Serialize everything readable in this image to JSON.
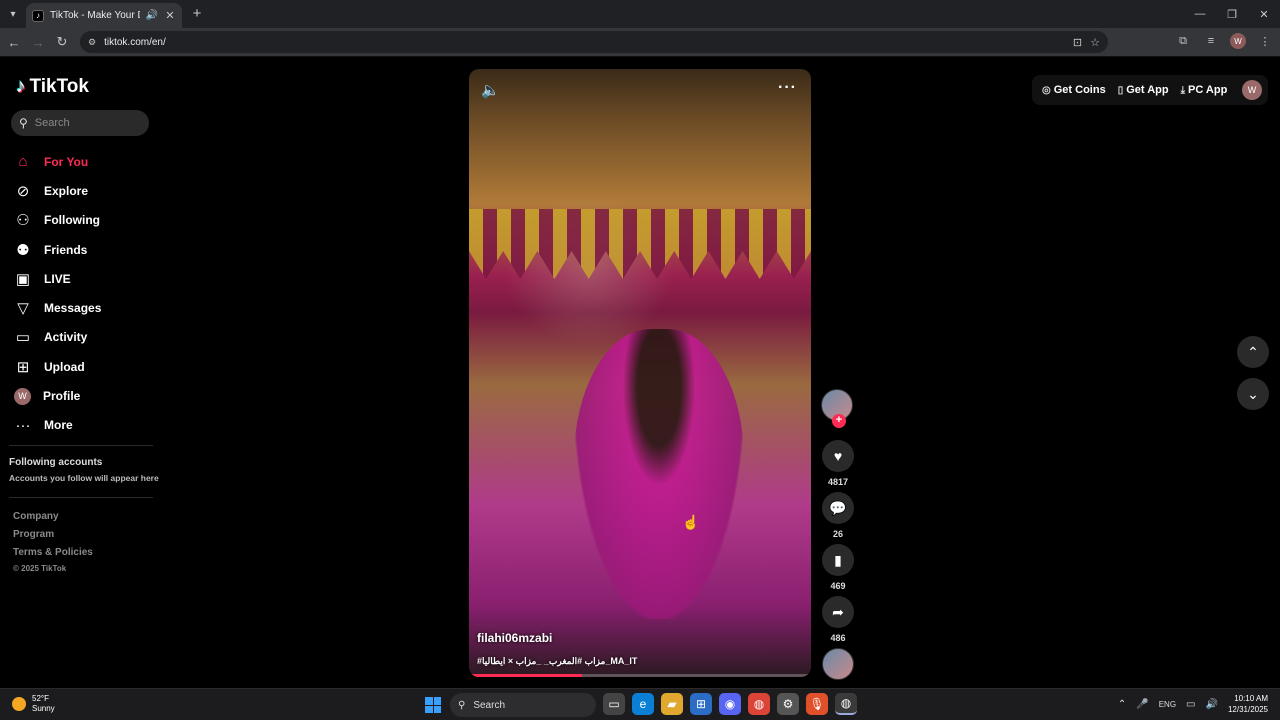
{
  "browser": {
    "tab_title": "TikTok - Make Your Day",
    "url": "tiktok.com/en/",
    "profile_initial": "W"
  },
  "sidebar": {
    "logo": "TikTok",
    "search_placeholder": "Search",
    "nav": [
      {
        "label": "For You",
        "icon": "home-icon",
        "active": true
      },
      {
        "label": "Explore",
        "icon": "compass-icon"
      },
      {
        "label": "Following",
        "icon": "user-follow-icon"
      },
      {
        "label": "Friends",
        "icon": "friends-icon"
      },
      {
        "label": "LIVE",
        "icon": "live-icon"
      },
      {
        "label": "Messages",
        "icon": "send-icon"
      },
      {
        "label": "Activity",
        "icon": "activity-icon"
      },
      {
        "label": "Upload",
        "icon": "upload-icon"
      },
      {
        "label": "Profile",
        "icon": "profile-avatar"
      },
      {
        "label": "More",
        "icon": "more-icon"
      }
    ],
    "profile_initial": "W",
    "following_title": "Following accounts",
    "following_sub": "Accounts you follow will appear here",
    "footer": [
      "Company",
      "Program",
      "Terms & Policies"
    ],
    "copyright": "© 2025 TikTok"
  },
  "video": {
    "author": "filahi06mzabi",
    "tags": "#مزاب #المغرب_ _مزاب × ايطاليا_MA_IT",
    "progress": 0.33
  },
  "actions": {
    "likes": "4817",
    "comments": "26",
    "saves": "469",
    "shares": "486"
  },
  "top_actions": {
    "get_coins": "Get Coins",
    "get_app": "Get App",
    "pc_app": "PC App",
    "profile_initial": "W"
  },
  "taskbar": {
    "temp": "52°F",
    "condition": "Sunny",
    "search": "Search",
    "lang": "ENG",
    "time": "10:10 AM",
    "date": "12/31/2025"
  },
  "colors": {
    "accent": "#fe2c55",
    "sidebar_bg": "#000000",
    "chrome_bg": "#202124"
  }
}
